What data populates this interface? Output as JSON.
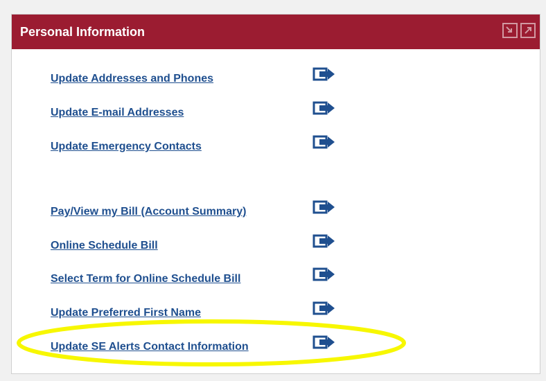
{
  "panel": {
    "title": "Personal Information",
    "header_color": "#9b1c31",
    "header_icons": [
      "restore-icon",
      "maximize-icon"
    ]
  },
  "links": [
    {
      "label": "Update Addresses and Phones"
    },
    {
      "label": "Update E-mail Addresses"
    },
    {
      "label": "Update Emergency Contacts"
    },
    {
      "label": "Pay/View my Bill (Account Summary)"
    },
    {
      "label": "Online Schedule Bill"
    },
    {
      "label": "Select Term for Online Schedule Bill"
    },
    {
      "label": "Update Preferred First Name"
    },
    {
      "label": "Update SE Alerts Contact Information"
    }
  ],
  "link_icon": "go-arrow-icon",
  "highlight": {
    "color": "#f7f700",
    "target": "Update SE Alerts Contact Information"
  }
}
